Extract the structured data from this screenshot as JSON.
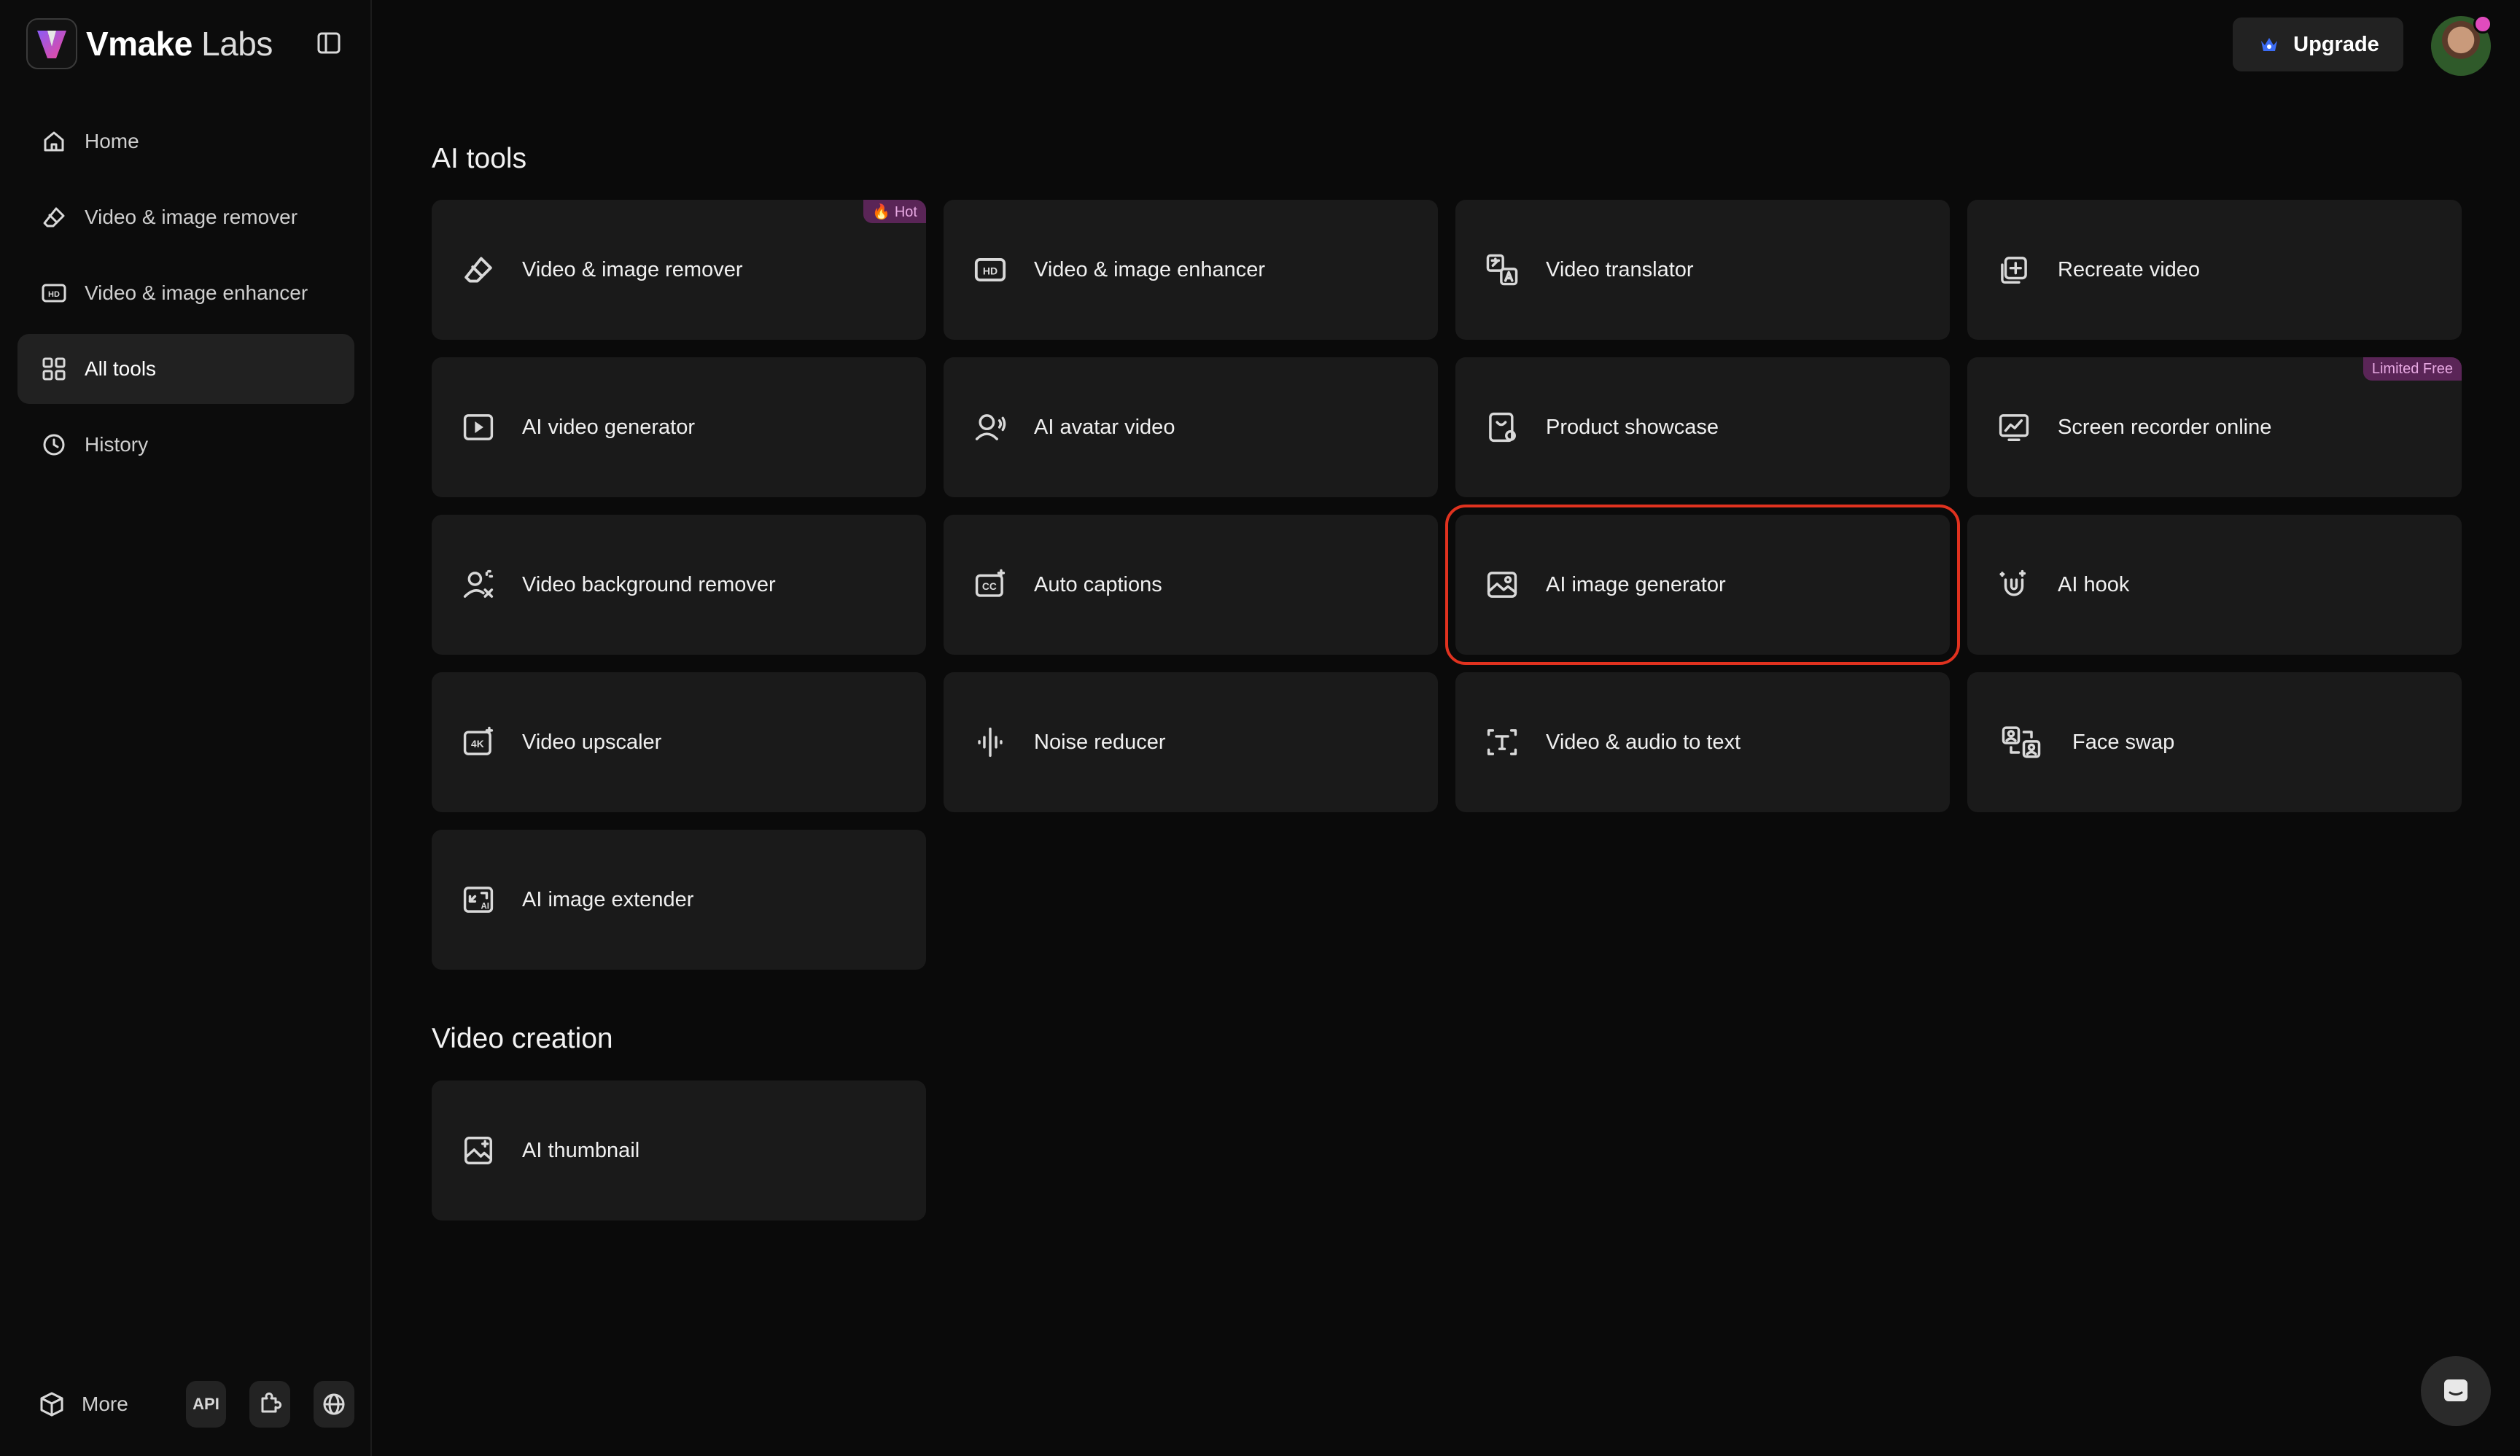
{
  "brand": {
    "name": "Vmake",
    "name_suffix": "Labs"
  },
  "sidebar": {
    "items": [
      {
        "label": "Home",
        "icon": "home-icon"
      },
      {
        "label": "Video & image remover",
        "icon": "eraser-icon"
      },
      {
        "label": "Video & image enhancer",
        "icon": "hd-icon"
      },
      {
        "label": "All tools",
        "icon": "grid-icon",
        "active": true
      },
      {
        "label": "History",
        "icon": "clock-icon"
      }
    ],
    "bottom": {
      "more_label": "More",
      "api_label": "API"
    }
  },
  "header": {
    "upgrade_label": "Upgrade"
  },
  "sections": {
    "ai_tools_title": "AI tools",
    "video_creation_title": "Video creation"
  },
  "tools": [
    {
      "label": "Video & image remover",
      "icon": "eraser-icon",
      "badge": "🔥 Hot"
    },
    {
      "label": "Video & image enhancer",
      "icon": "hd-icon"
    },
    {
      "label": "Video translator",
      "icon": "translate-icon"
    },
    {
      "label": "Recreate video",
      "icon": "recreate-icon"
    },
    {
      "label": "AI video generator",
      "icon": "play-icon"
    },
    {
      "label": "AI avatar video",
      "icon": "avatar-speaking-icon"
    },
    {
      "label": "Product showcase",
      "icon": "product-icon"
    },
    {
      "label": "Screen recorder online",
      "icon": "screen-chart-icon",
      "badge": "Limited Free"
    },
    {
      "label": "Video background remover",
      "icon": "person-remove-bg-icon"
    },
    {
      "label": "Auto captions",
      "icon": "cc-icon"
    },
    {
      "label": "AI image generator",
      "icon": "image-icon",
      "selected": true
    },
    {
      "label": "AI hook",
      "icon": "magnet-icon"
    },
    {
      "label": "Video upscaler",
      "icon": "4k-icon"
    },
    {
      "label": "Noise reducer",
      "icon": "audio-wave-icon"
    },
    {
      "label": "Video & audio to text",
      "icon": "text-scan-icon"
    },
    {
      "label": "Face swap",
      "icon": "face-swap-icon"
    },
    {
      "label": "AI image extender",
      "icon": "expand-ai-icon"
    }
  ],
  "video_creation": [
    {
      "label": "AI thumbnail",
      "icon": "thumbnail-icon"
    }
  ],
  "colors": {
    "selection_outline": "#e0321f",
    "badge_bg": "#5a2557",
    "badge_text": "#e8a9e3",
    "logo_gradient": [
      "#8b5cf6",
      "#ec4899"
    ]
  }
}
